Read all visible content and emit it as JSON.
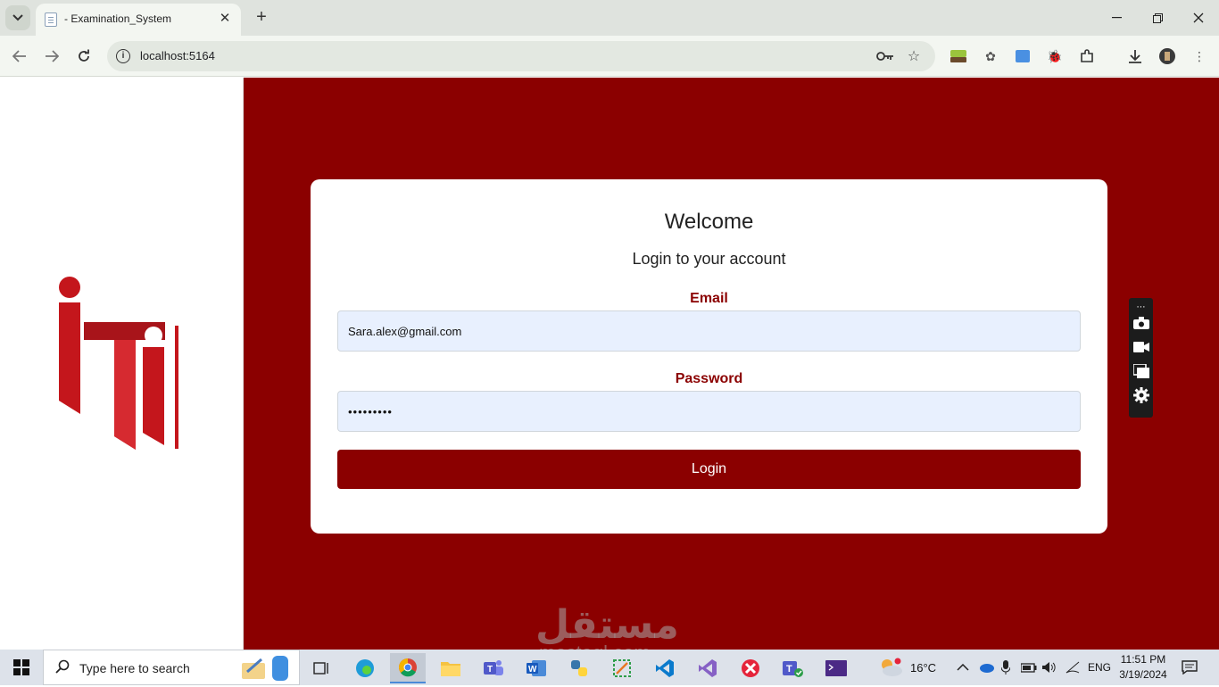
{
  "browser": {
    "tab_title": "- Examination_System",
    "url": "localhost:5164",
    "new_tab": "+",
    "close_tab": "✕"
  },
  "page": {
    "heading": "Welcome",
    "subheading": "Login to your account",
    "email_label": "Email",
    "email_value": "Sara.alex@gmail.com",
    "password_label": "Password",
    "password_value": "•••••••••",
    "login_button": "Login",
    "logo_text": "iti",
    "accent_color": "#8b0000",
    "watermark": "مستقل",
    "watermark_sub": "mostaql.com"
  },
  "taskbar": {
    "search_placeholder": "Type here to search",
    "weather": "16°C",
    "language": "ENG",
    "time": "11:51 PM",
    "date": "3/19/2024"
  }
}
